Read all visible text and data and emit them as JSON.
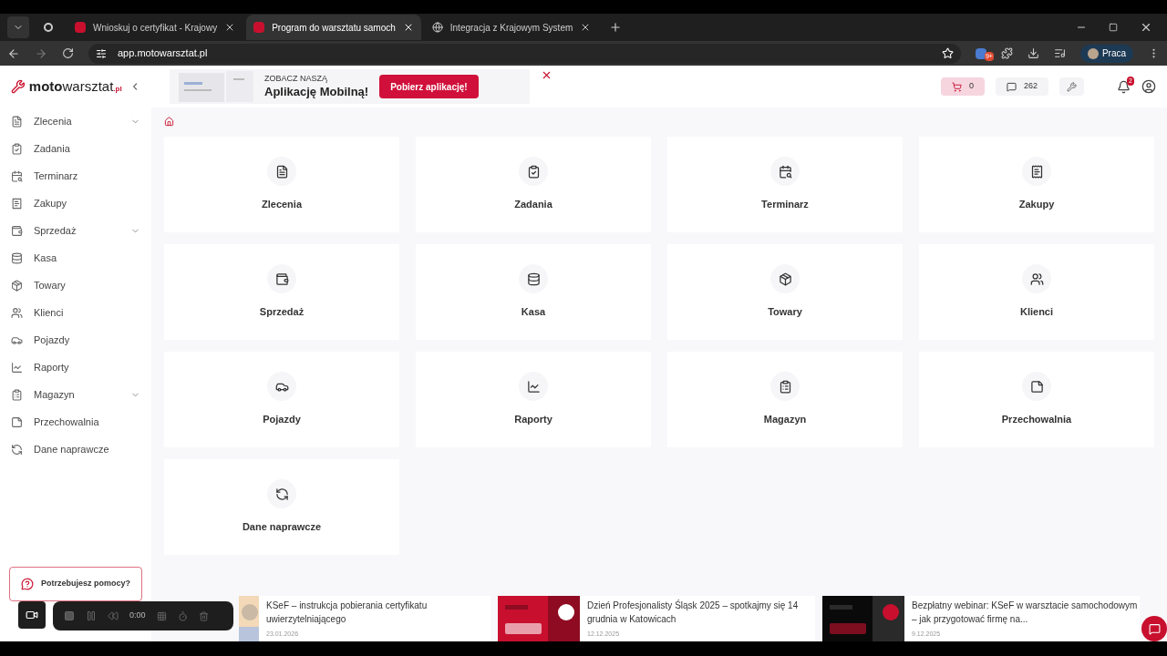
{
  "browser": {
    "tabs": [
      {
        "title": "Wnioskuj o certyfikat - Krajowy",
        "selected": false
      },
      {
        "title": "Program do warsztatu samoch",
        "selected": true
      },
      {
        "title": "Integracja z Krajowym System",
        "selected": false
      }
    ],
    "url": "app.motowarsztat.pl",
    "extension_badge": "9+",
    "profile": "Praca"
  },
  "logo": {
    "main": "moto",
    "accent": "warsztat",
    "suffix": ".pl"
  },
  "banner": {
    "eyebrow": "ZOBACZ NASZĄ",
    "title": "Aplikację Mobilną!",
    "button": "Pobierz aplikację!"
  },
  "header": {
    "cart_count": "0",
    "messages_count": "262",
    "notifications_badge": "2"
  },
  "sidebar": {
    "items": [
      {
        "label": "Zlecenia",
        "expandable": true
      },
      {
        "label": "Zadania",
        "expandable": false
      },
      {
        "label": "Terminarz",
        "expandable": false
      },
      {
        "label": "Zakupy",
        "expandable": false
      },
      {
        "label": "Sprzedaż",
        "expandable": true
      },
      {
        "label": "Kasa",
        "expandable": false
      },
      {
        "label": "Towary",
        "expandable": false
      },
      {
        "label": "Klienci",
        "expandable": false
      },
      {
        "label": "Pojazdy",
        "expandable": false
      },
      {
        "label": "Raporty",
        "expandable": false
      },
      {
        "label": "Magazyn",
        "expandable": true
      },
      {
        "label": "Przechowalnia",
        "expandable": false
      },
      {
        "label": "Dane naprawcze",
        "expandable": false
      }
    ],
    "help": "Potrzebujesz pomocy?"
  },
  "tiles": [
    "Zlecenia",
    "Zadania",
    "Terminarz",
    "Zakupy",
    "Sprzedaż",
    "Kasa",
    "Towary",
    "Klienci",
    "Pojazdy",
    "Raporty",
    "Magazyn",
    "Przechowalnia",
    "Dane naprawcze"
  ],
  "news": [
    {
      "title": "KSeF – instrukcja pobierania certyfikatu uwierzytelniającego",
      "date": "23.01.2026"
    },
    {
      "title": "Dzień Profesjonalisty Śląsk 2025 – spotkajmy się 14 grudnia w Katowicach",
      "date": "12.12.2025"
    },
    {
      "title": "Bezpłatny webinar: KSeF w warsztacie samochodowym – jak przygotować firmę na...",
      "date": "9.12.2025"
    }
  ],
  "recorder": {
    "time": "0:00"
  }
}
